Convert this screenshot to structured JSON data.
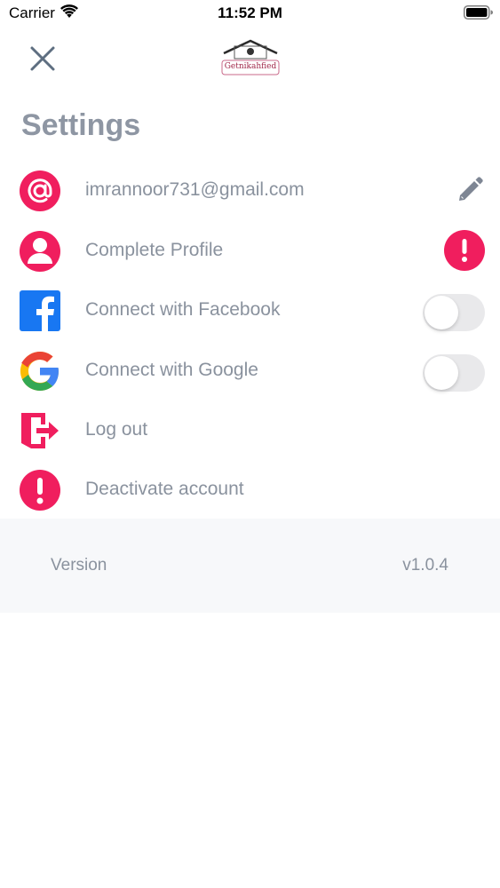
{
  "status_bar": {
    "carrier": "Carrier",
    "time": "11:52 PM"
  },
  "header": {
    "logo_text": "Getnikahfied",
    "title": "Settings"
  },
  "settings_items": [
    {
      "label": "imrannoor731@gmail.com",
      "icon": "at-icon",
      "right": "pencil-icon"
    },
    {
      "label": "Complete Profile",
      "icon": "user-icon",
      "right": "alert-icon"
    },
    {
      "label": "Connect with Facebook",
      "icon": "facebook-icon",
      "right": "toggle",
      "toggle_on": false
    },
    {
      "label": "Connect with Google",
      "icon": "google-icon",
      "right": "toggle",
      "toggle_on": false
    },
    {
      "label": "Log out",
      "icon": "logout-icon"
    },
    {
      "label": "Deactivate account",
      "icon": "alert-icon"
    }
  ],
  "version": {
    "label": "Version",
    "value": "v1.0.4"
  },
  "colors": {
    "accent": "#f01e5e",
    "text_muted": "#8a929e",
    "title": "#8e96a3",
    "facebook": "#1877f2",
    "section_bg": "#f7f8fa"
  }
}
